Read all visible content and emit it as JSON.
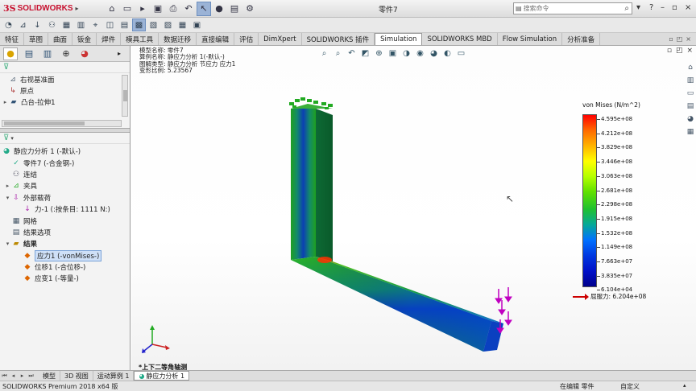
{
  "app": {
    "brand_prefix": "3S",
    "brand_name": "SOLIDWORKS",
    "document_title": "零件7"
  },
  "search": {
    "placeholder": "搜索命令"
  },
  "command_tabs": [
    "特征",
    "草图",
    "曲面",
    "钣金",
    "焊件",
    "模具工具",
    "数据迁移",
    "直接编辑",
    "评估",
    "DimXpert",
    "SOLIDWORKS 插件",
    "Simulation",
    "SOLIDWORKS MBD",
    "Flow Simulation",
    "分析准备"
  ],
  "active_tab": "Simulation",
  "tree_top": [
    {
      "label": "右视基准面",
      "icon": "plane-icon"
    },
    {
      "label": "原点",
      "icon": "origin-icon"
    },
    {
      "label": "凸台-拉伸1",
      "icon": "extrude-icon",
      "expandable": true
    }
  ],
  "study_tree": [
    {
      "label": "静应力分析 1 (-默认-)",
      "indent": 0,
      "exp": ""
    },
    {
      "label": "零件7 (-合金钢-)",
      "indent": 1,
      "exp": ""
    },
    {
      "label": "连结",
      "indent": 1,
      "exp": ""
    },
    {
      "label": "夹具",
      "indent": 1,
      "exp": "▸"
    },
    {
      "label": "外部载荷",
      "indent": 1,
      "exp": "▾"
    },
    {
      "label": "力-1 (:按条目: 1111 N:)",
      "indent": 2,
      "exp": ""
    },
    {
      "label": "网格",
      "indent": 1,
      "exp": ""
    },
    {
      "label": "结果选项",
      "indent": 1,
      "exp": ""
    },
    {
      "label": "结果",
      "indent": 1,
      "exp": "▾"
    },
    {
      "label": "应力1 (-vonMises-)",
      "indent": 2,
      "exp": "",
      "selected": true
    },
    {
      "label": "位移1 (-合位移-)",
      "indent": 2,
      "exp": ""
    },
    {
      "label": "应变1 (-等量-)",
      "indent": 2,
      "exp": ""
    }
  ],
  "info_lines": [
    "模型名称: 零件7",
    "算例名称: 静应力分析 1(-默认-)",
    "图解类型: 静应力分析 节应力 应力1",
    "变形比例: 5.23567"
  ],
  "legend": {
    "title": "von Mises (N/m^2)",
    "ticks": [
      "4.595e+08",
      "4.212e+08",
      "3.829e+08",
      "3.446e+08",
      "3.063e+08",
      "2.681e+08",
      "2.298e+08",
      "1.915e+08",
      "1.532e+08",
      "1.149e+08",
      "7.663e+07",
      "3.835e+07",
      "6.104e+04"
    ],
    "yield_label": "屈服力: 6.204e+08"
  },
  "view_label": "*上下二等角轴测",
  "bottom_tabs": [
    "模型",
    "3D 视图",
    "运动算例 1",
    "静应力分析 1"
  ],
  "active_bottom_tab": "静应力分析 1",
  "status": {
    "left": "SOLIDWORKS Premium 2018 x64 版",
    "editing": "在编辑 零件",
    "custom": "自定义"
  },
  "colors": {
    "brand": "#c8102e",
    "selection": "#cfe0f7",
    "load_arrow": "#c000c0",
    "fixture": "#22aa22"
  }
}
